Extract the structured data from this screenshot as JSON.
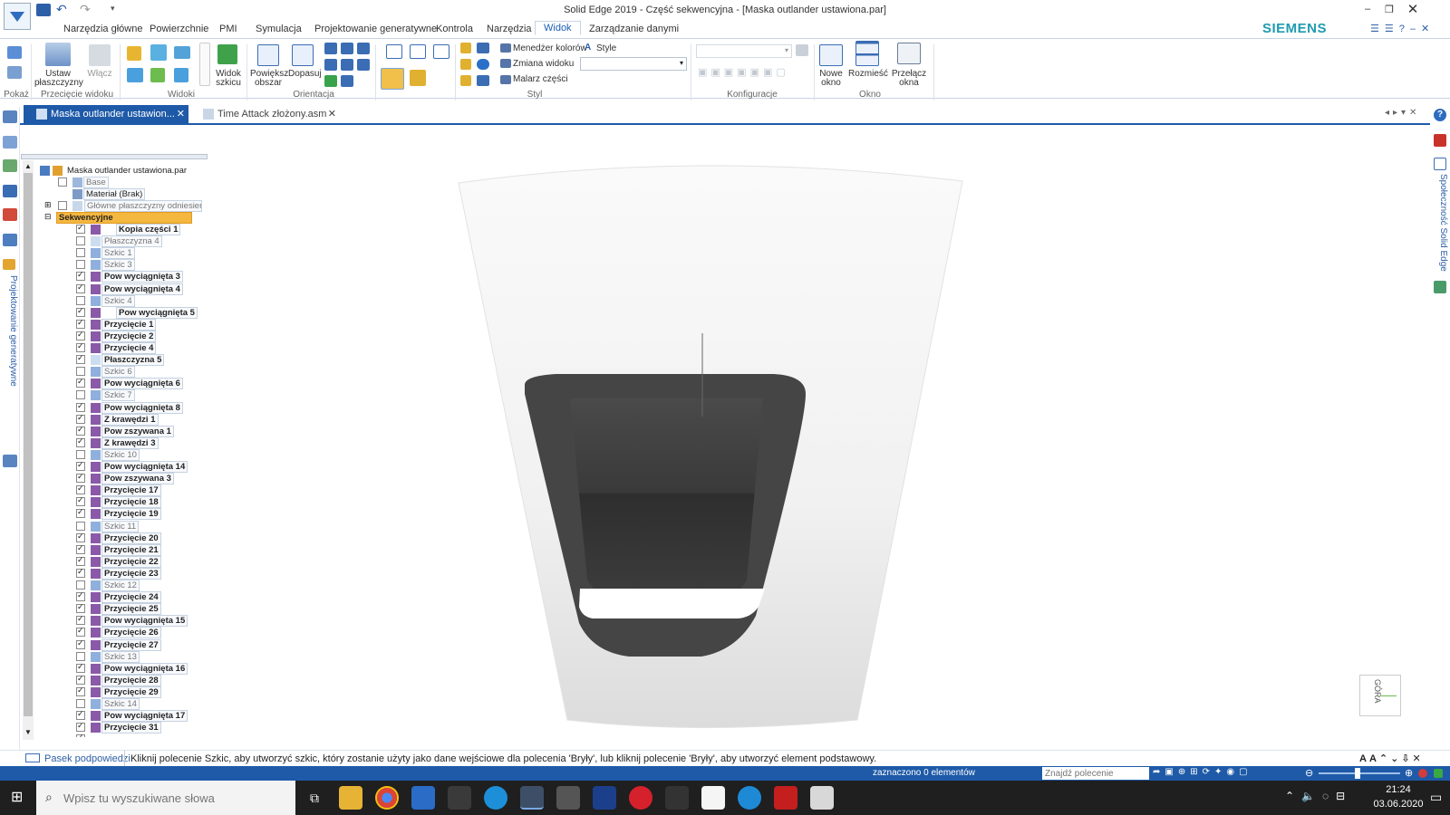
{
  "window": {
    "title": "Solid Edge 2019 - Część sekwencyjna - [Maska outlander ustawiona.par]",
    "brand": "SIEMENS"
  },
  "ribbon_tabs": [
    "Narzędzia główne",
    "Powierzchnie",
    "PMI",
    "Symulacja",
    "Projektowanie generatywne",
    "Kontrola",
    "Narzędzia",
    "Widok",
    "Zarządzanie danymi"
  ],
  "ribbon": {
    "pokaz": "Pokaż",
    "ustaw": "Ustaw płaszczyzny",
    "wlacz": "Włącz",
    "przeciecie_widoku": "Przecięcie widoku",
    "widok_szkicu": "Widok szkicu",
    "widoki": "Widoki",
    "powieksz": "Powiększ obszar",
    "dopasuj": "Dopasuj",
    "orientacja": "Orientacja",
    "menedzer": "Menedżer kolorów",
    "style": "Style",
    "zmiana": "Zmiana widoku",
    "malarz": "Malarz części",
    "styl": "Styl",
    "konfiguracje": "Konfiguracje",
    "nowe_okno": "Nowe okno",
    "rozmiesc": "Rozmieść",
    "przelacz": "Przełącz okna",
    "okno": "Okno"
  },
  "doc_tabs": [
    {
      "label": "Maska outlander ustawion...",
      "active": true
    },
    {
      "label": "Time Attack złożony.asm",
      "active": false
    }
  ],
  "left_panel_label": "Projektowanie generatywne",
  "right_panel_label": "Społeczność Solid Edge",
  "tree": {
    "root": "Maska outlander ustawiona.par",
    "base": "Base",
    "material": "Materiał (Brak)",
    "glowne": "Główne płaszczyzny odniesienia",
    "sekwencyjne": "Sekwencyjne",
    "items": [
      {
        "label": "Kopia części 1",
        "checked": true,
        "bold": true
      },
      {
        "label": "Płaszczyzna 4",
        "checked": false,
        "bold": false
      },
      {
        "label": "Szkic 1",
        "checked": false,
        "bold": false
      },
      {
        "label": "Szkic 3",
        "checked": false,
        "bold": false
      },
      {
        "label": "Pow wyciągnięta 3",
        "checked": true,
        "bold": true
      },
      {
        "label": "Pow wyciągnięta 4",
        "checked": true,
        "bold": true
      },
      {
        "label": "Szkic 4",
        "checked": false,
        "bold": false
      },
      {
        "label": "Pow wyciągnięta 5",
        "checked": true,
        "bold": true
      },
      {
        "label": "Przycięcie 1",
        "checked": true,
        "bold": true
      },
      {
        "label": "Przycięcie 2",
        "checked": true,
        "bold": true
      },
      {
        "label": "Przycięcie 4",
        "checked": true,
        "bold": true
      },
      {
        "label": "Płaszczyzna 5",
        "checked": true,
        "bold": true
      },
      {
        "label": "Szkic 6",
        "checked": false,
        "bold": false
      },
      {
        "label": "Pow wyciągnięta 6",
        "checked": true,
        "bold": true
      },
      {
        "label": "Szkic 7",
        "checked": false,
        "bold": false
      },
      {
        "label": "Pow wyciągnięta 8",
        "checked": true,
        "bold": true
      },
      {
        "label": "Z krawędzi 1",
        "checked": true,
        "bold": true
      },
      {
        "label": "Pow zszywana 1",
        "checked": true,
        "bold": true
      },
      {
        "label": "Z krawędzi 3",
        "checked": true,
        "bold": true
      },
      {
        "label": "Szkic 10",
        "checked": false,
        "bold": false
      },
      {
        "label": "Pow wyciągnięta 14",
        "checked": true,
        "bold": true
      },
      {
        "label": "Pow zszywana 3",
        "checked": true,
        "bold": true
      },
      {
        "label": "Przycięcie 17",
        "checked": true,
        "bold": true
      },
      {
        "label": "Przycięcie 18",
        "checked": true,
        "bold": true
      },
      {
        "label": "Przycięcie 19",
        "checked": true,
        "bold": true
      },
      {
        "label": "Szkic 11",
        "checked": false,
        "bold": false
      },
      {
        "label": "Przycięcie 20",
        "checked": true,
        "bold": true
      },
      {
        "label": "Przycięcie 21",
        "checked": true,
        "bold": true
      },
      {
        "label": "Przycięcie 22",
        "checked": true,
        "bold": true
      },
      {
        "label": "Przycięcie 23",
        "checked": true,
        "bold": true
      },
      {
        "label": "Szkic 12",
        "checked": false,
        "bold": false
      },
      {
        "label": "Przycięcie 24",
        "checked": true,
        "bold": true
      },
      {
        "label": "Przycięcie 25",
        "checked": true,
        "bold": true
      },
      {
        "label": "Pow wyciągnięta 15",
        "checked": true,
        "bold": true
      },
      {
        "label": "Przycięcie 26",
        "checked": true,
        "bold": true
      },
      {
        "label": "Przycięcie 27",
        "checked": true,
        "bold": true
      },
      {
        "label": "Szkic 13",
        "checked": false,
        "bold": false
      },
      {
        "label": "Pow wyciągnięta 16",
        "checked": true,
        "bold": true
      },
      {
        "label": "Przycięcie 28",
        "checked": true,
        "bold": true
      },
      {
        "label": "Przycięcie 29",
        "checked": true,
        "bold": true
      },
      {
        "label": "Szkic 14",
        "checked": false,
        "bold": false
      },
      {
        "label": "Pow wyciągnięta 17",
        "checked": true,
        "bold": true
      },
      {
        "label": "Przycięcie 31",
        "checked": true,
        "bold": true
      }
    ]
  },
  "view_cube": "GÓRA",
  "prompt": {
    "label": "Pasek podpowiedzi",
    "text": "Kliknij polecenie Szkic, aby utworzyć szkic, który zostanie użyty jako dane wejściowe dla polecenia 'Bryły', lub kliknij polecenie 'Bryły', aby utworzyć element podstawowy."
  },
  "status": {
    "selected": "zaznaczono 0 elementów",
    "search_placeholder": "Znajdź polecenie"
  },
  "taskbar": {
    "search_placeholder": "Wpisz tu wyszukiwane słowa",
    "time": "21:24",
    "date": "03.06.2020"
  },
  "colors": {
    "accent": "#1e5aa8",
    "taskbar": "#1f1f1f",
    "brand": "#1f9bb0"
  }
}
